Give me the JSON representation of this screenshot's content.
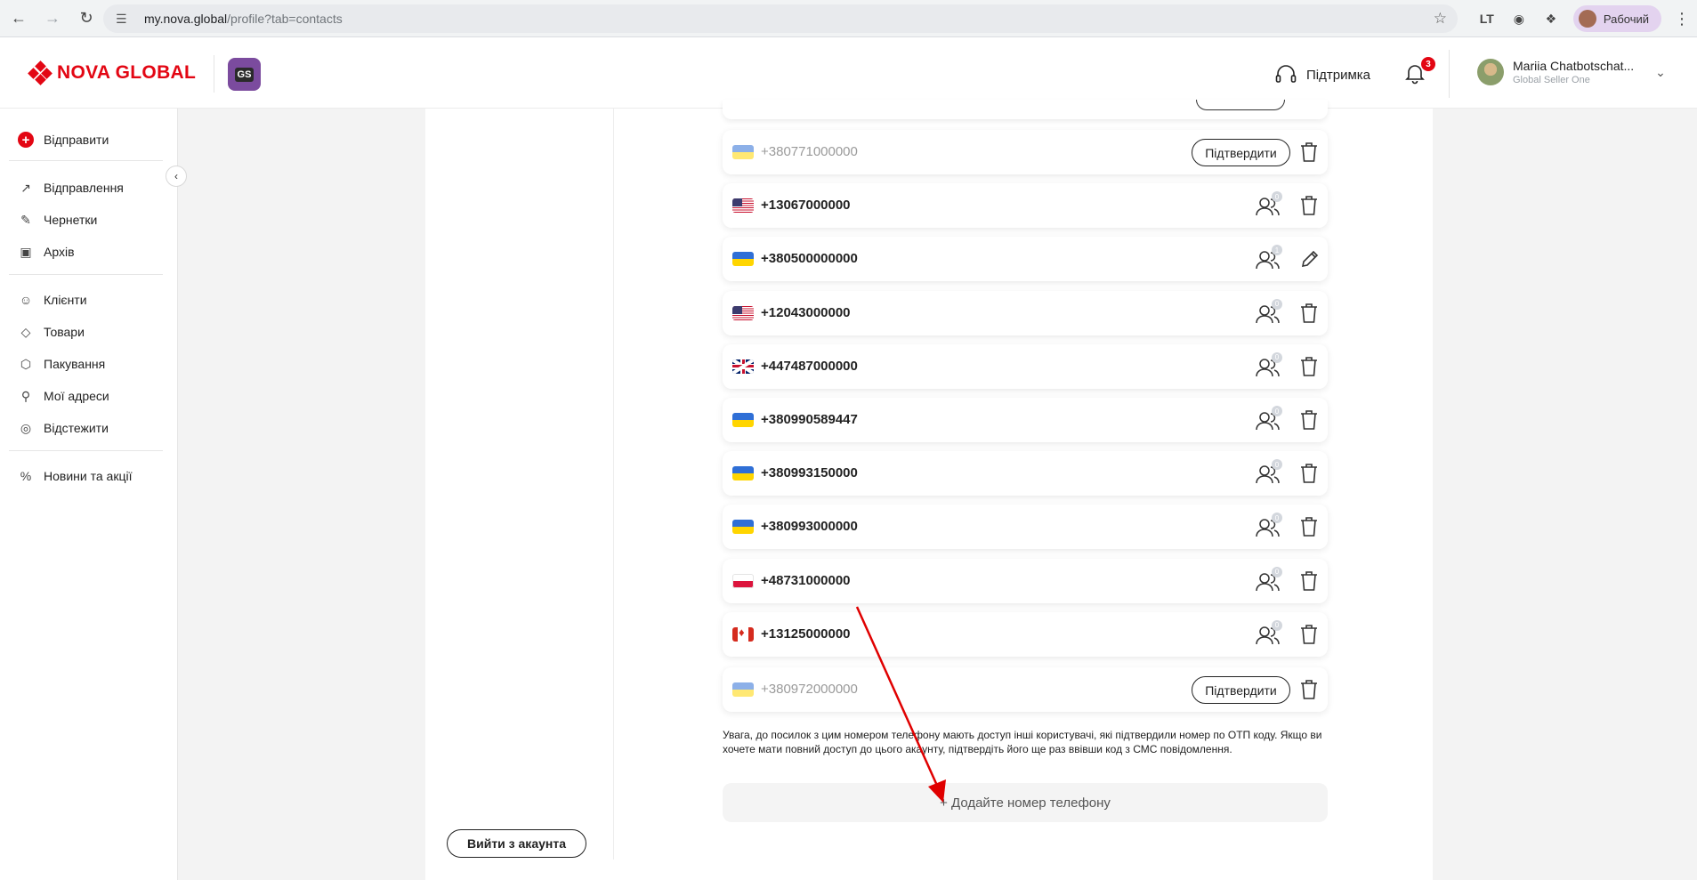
{
  "browser": {
    "url_host": "my.nova.global",
    "url_path": "/profile?tab=contacts",
    "profile_label": "Рабочий",
    "extension_label": "LT"
  },
  "header": {
    "logo_text": "NOVA GLOBAL",
    "badge_text": "GS",
    "support_label": "Підтримка",
    "notification_count": "3",
    "user_name": "Mariia Chatbotschat...",
    "user_role": "Global Seller One"
  },
  "sidebar": {
    "items": [
      {
        "label": "Відправити",
        "icon": "plus-circle-icon"
      },
      {
        "label": "Відправлення",
        "icon": "arrow-up-right-icon"
      },
      {
        "label": "Чернетки",
        "icon": "edit-icon"
      },
      {
        "label": "Архів",
        "icon": "archive-icon"
      },
      {
        "label": "Клієнти",
        "icon": "users-icon"
      },
      {
        "label": "Товари",
        "icon": "tag-icon"
      },
      {
        "label": "Пакування",
        "icon": "box-icon"
      },
      {
        "label": "Мої адреси",
        "icon": "location-pin-icon"
      },
      {
        "label": "Відстежити",
        "icon": "target-icon"
      },
      {
        "label": "Новини та акції",
        "icon": "percent-icon"
      }
    ]
  },
  "phones": [
    {
      "number": "+380771000000",
      "flag": "ua",
      "status": "unverified",
      "confirm_label": "Підтвердити",
      "action": "trash"
    },
    {
      "number": "+13067000000",
      "flag": "us",
      "status": "verified",
      "users": "0",
      "action": "trash"
    },
    {
      "number": "+380500000000",
      "flag": "ua",
      "status": "verified",
      "users": "1",
      "action": "edit"
    },
    {
      "number": "+12043000000",
      "flag": "us",
      "status": "verified",
      "users": "0",
      "action": "trash"
    },
    {
      "number": "+447487000000",
      "flag": "gb",
      "status": "verified",
      "users": "0",
      "action": "trash"
    },
    {
      "number": "+380990589447",
      "flag": "ua",
      "status": "verified",
      "users": "0",
      "action": "trash"
    },
    {
      "number": "+380993150000",
      "flag": "ua",
      "status": "verified",
      "users": "0",
      "action": "trash"
    },
    {
      "number": "+380993000000",
      "flag": "ua",
      "status": "verified",
      "users": "0",
      "action": "trash"
    },
    {
      "number": "+48731000000",
      "flag": "pl",
      "status": "verified",
      "users": "0",
      "action": "trash"
    },
    {
      "number": "+13125000000",
      "flag": "ca",
      "status": "verified",
      "users": "0",
      "action": "trash"
    },
    {
      "number": "+380972000000",
      "flag": "ua",
      "status": "unverified",
      "confirm_label": "Підтвердити",
      "action": "trash"
    }
  ],
  "notice_text": "Увага, до посилок з цим номером телефону мають доступ інші користувачі, які підтвердили номер по ОТП коду. Якщо ви хочете мати повний доступ до цього акаунту, підтвердіть його ще раз ввівши код з СМС повідомлення.",
  "add_phone_label": "+ Додайте номер телефону",
  "logout_label": "Вийти з акаунта",
  "colors": {
    "brand_red": "#e30613",
    "badge_purple": "#7b4b9e",
    "annotation_arrow": "#e00000"
  }
}
